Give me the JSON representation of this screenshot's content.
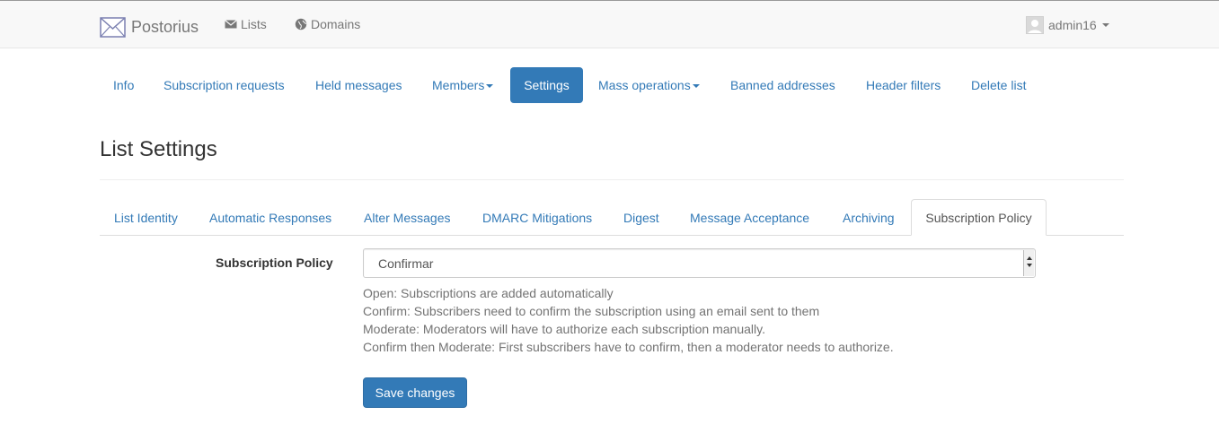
{
  "navbar": {
    "brand": "Postorius",
    "links": [
      {
        "label": "Lists",
        "icon": "envelope-icon"
      },
      {
        "label": "Domains",
        "icon": "globe-icon"
      }
    ],
    "user": "admin16"
  },
  "list_nav": [
    {
      "label": "Info"
    },
    {
      "label": "Subscription requests"
    },
    {
      "label": "Held messages"
    },
    {
      "label": "Members",
      "dropdown": true
    },
    {
      "label": "Settings",
      "active": true
    },
    {
      "label": "Mass operations",
      "dropdown": true
    },
    {
      "label": "Banned addresses"
    },
    {
      "label": "Header filters"
    },
    {
      "label": "Delete list"
    }
  ],
  "page_title": "List Settings",
  "settings_tabs": [
    {
      "label": "List Identity"
    },
    {
      "label": "Automatic Responses"
    },
    {
      "label": "Alter Messages"
    },
    {
      "label": "DMARC Mitigations"
    },
    {
      "label": "Digest"
    },
    {
      "label": "Message Acceptance"
    },
    {
      "label": "Archiving"
    },
    {
      "label": "Subscription Policy",
      "active": true
    }
  ],
  "form": {
    "label": "Subscription Policy",
    "selected_value": "Confirmar",
    "help_lines": [
      "Open: Subscriptions are added automatically",
      "Confirm: Subscribers need to confirm the subscription using an email sent to them",
      "Moderate: Moderators will have to authorize each subscription manually.",
      "Confirm then Moderate: First subscribers have to confirm, then a moderator needs to authorize."
    ],
    "save_label": "Save changes"
  },
  "colors": {
    "link": "#337ab7",
    "primary": "#337ab7",
    "navbar_bg": "#f8f8f8",
    "muted_text": "#737373"
  }
}
